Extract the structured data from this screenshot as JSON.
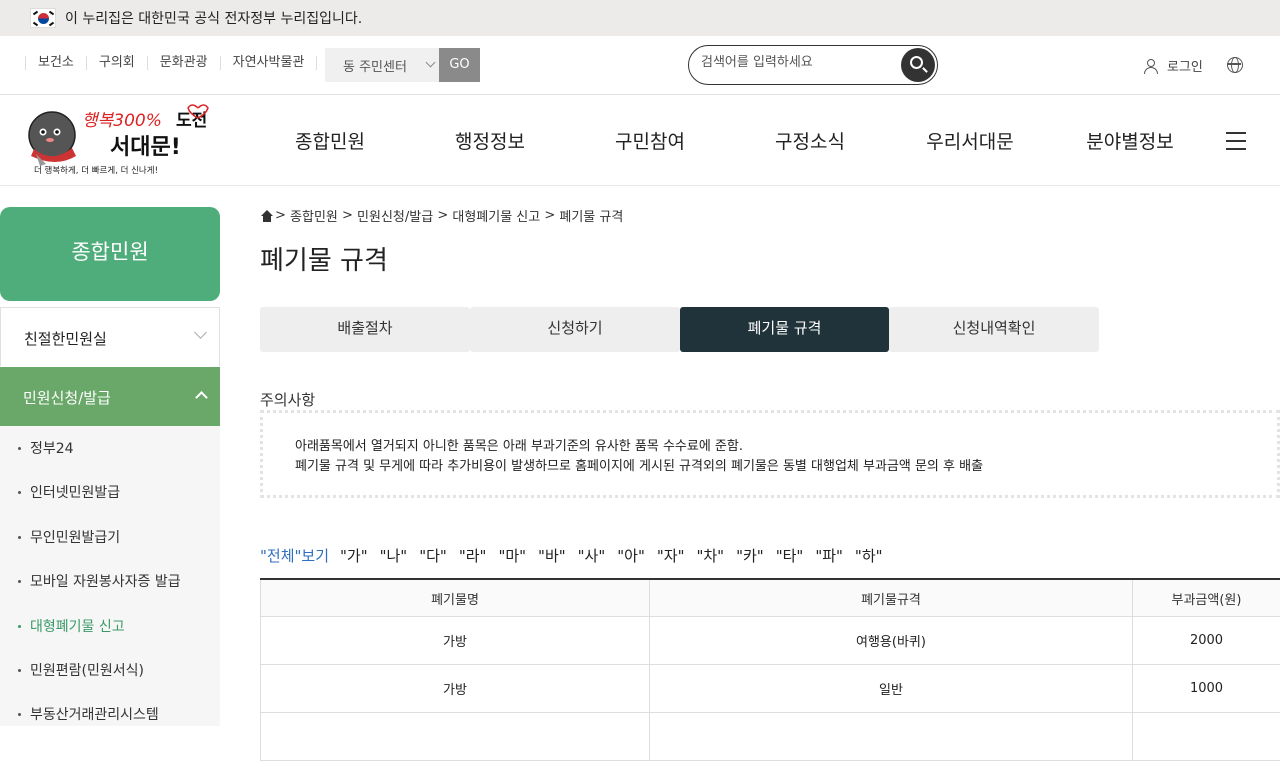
{
  "gov_banner": {
    "text": "이 누리집은 대한민국 공식 전자정부 누리집입니다."
  },
  "util": {
    "links": [
      "보건소",
      "구의회",
      "문화관광",
      "자연사박물관"
    ],
    "dong_select": "동 주민센터",
    "go_label": "GO",
    "search_placeholder": "검색어를 입력하세요",
    "login_label": "로그인"
  },
  "header": {
    "logo_main": "행복300% 도전 서대문!",
    "logo_sub": "더 행복하게, 더 빠르게, 더 신나게!",
    "gnb": [
      "종합민원",
      "행정정보",
      "구민참여",
      "구정소식",
      "우리서대문",
      "분야별정보"
    ]
  },
  "sidebar": {
    "title": "종합민원",
    "sections": [
      {
        "label": "친절한민원실"
      },
      {
        "label": "민원신청/발급"
      }
    ],
    "sub_items": [
      "정부24",
      "인터넷민원발급",
      "무인민원발급기",
      "모바일 자원봉사자증 발급",
      "대형폐기물 신고",
      "민원편람(민원서식)",
      "부동산거래관리시스템"
    ]
  },
  "breadcrumb": [
    "종합민원",
    "민원신청/발급",
    "대형폐기물 신고",
    "폐기물 규격"
  ],
  "page_title": "폐기물 규격",
  "tabs": [
    "배출절차",
    "신청하기",
    "폐기물 규격",
    "신청내역확인"
  ],
  "notice": {
    "title": "주의사항",
    "lines": [
      "아래품목에서 열거되지 아니한 품목은 아래 부과기준의 유사한 품목 수수료에 준함.",
      "폐기물 규격 및 무게에 따라 추가비용이 발생하므로 홈페이지에 게시된 규격외의 폐기물은 동별 대행업체 부과금액 문의 후 배출"
    ]
  },
  "index_bar": {
    "all": "\"전체\"보기",
    "chars": [
      "\"가\"",
      "\"나\"",
      "\"다\"",
      "\"라\"",
      "\"마\"",
      "\"바\"",
      "\"사\"",
      "\"아\"",
      "\"자\"",
      "\"차\"",
      "\"카\"",
      "\"타\"",
      "\"파\"",
      "\"하\""
    ]
  },
  "table": {
    "headers": [
      "폐기물명",
      "폐기물규격",
      "부과금액(원)"
    ],
    "rows": [
      [
        "가방",
        "여행용(바퀴)",
        "2000"
      ],
      [
        "가방",
        "일반",
        "1000"
      ]
    ]
  },
  "colors": {
    "sidebar_title": "#4fac7b",
    "sidebar_active": "#6aa86a",
    "tab_active": "#21333a",
    "index_all": "#2f6fc0"
  }
}
